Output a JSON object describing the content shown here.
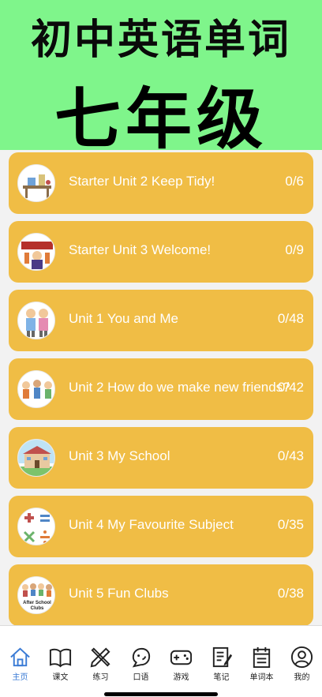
{
  "banner": {
    "line1": "初中英语单词",
    "line2": "七年级",
    "bg_color": "#7ff58b"
  },
  "units": [
    {
      "title": "Starter Unit 2 Keep Tidy!",
      "count": "0/6",
      "icon": "tidy-desk-picture"
    },
    {
      "title": "Starter Unit 3 Welcome!",
      "count": "0/9",
      "icon": "welcome-banner-picture"
    },
    {
      "title": "Unit 1 You and Me",
      "count": "0/48",
      "icon": "two-friends-picture"
    },
    {
      "title": "Unit 2 How do we make new friends?",
      "count": "0/42",
      "icon": "group-of-kids-picture"
    },
    {
      "title": "Unit 3 My School",
      "count": "0/43",
      "icon": "school-building-picture"
    },
    {
      "title": "Unit 4 My Favourite Subject",
      "count": "0/35",
      "icon": "math-symbols-picture"
    },
    {
      "title": "Unit 5 Fun Clubs",
      "count": "0/38",
      "icon": "after-school-clubs-picture"
    }
  ],
  "after_school_clubs_text": "After School Clubs",
  "card_color": "#f0bd45",
  "tabs": [
    {
      "label": "主页",
      "icon": "home-icon",
      "active": true
    },
    {
      "label": "课文",
      "icon": "book-icon"
    },
    {
      "label": "练习",
      "icon": "pencil-ruler-icon"
    },
    {
      "label": "口语",
      "icon": "speech-face-icon"
    },
    {
      "label": "游戏",
      "icon": "gamepad-icon"
    },
    {
      "label": "笔记",
      "icon": "notebook-pen-icon"
    },
    {
      "label": "单词本",
      "icon": "calendar-book-icon"
    },
    {
      "label": "我的",
      "icon": "user-profile-icon"
    }
  ],
  "accent_color": "#3a7bd5"
}
